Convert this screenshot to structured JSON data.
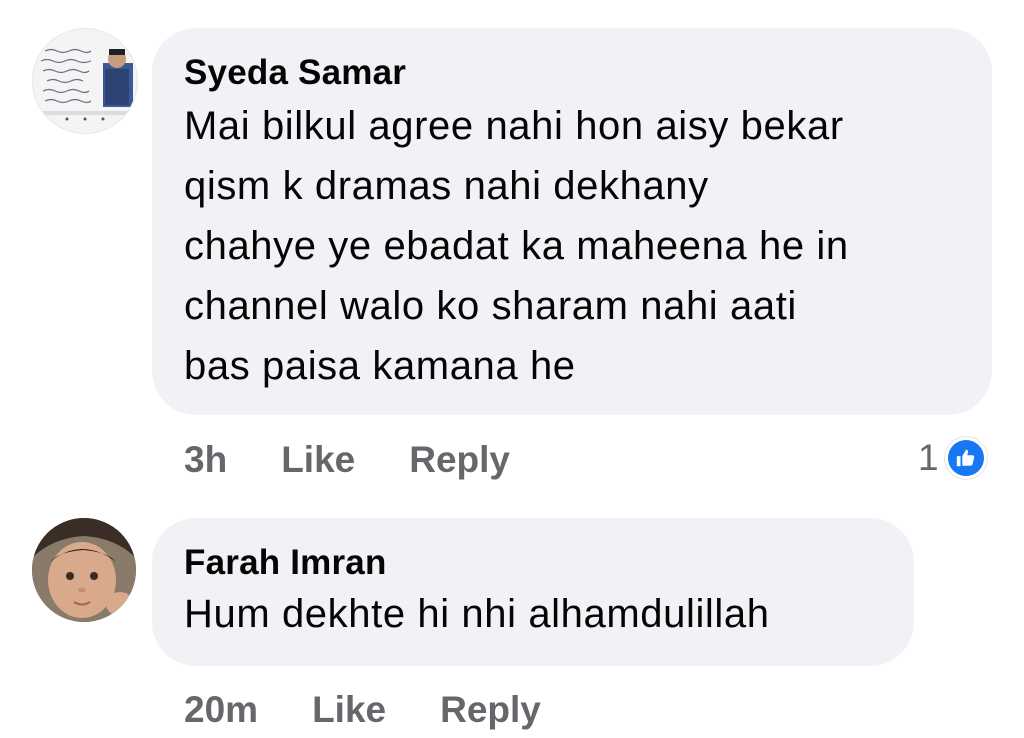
{
  "comments": [
    {
      "author": "Syeda Samar",
      "text_lines": [
        "Mai bilkul agree nahi hon aisy bekar",
        "qism k dramas nahi dekhany",
        "chahye ye ebadat ka maheena he in",
        "channel walo ko sharam nahi aati",
        "bas paisa kamana he"
      ],
      "time": "3h",
      "like_label": "Like",
      "reply_label": "Reply",
      "reaction_count": "1",
      "reaction_icon": "thumbs-up-icon",
      "avatar": "profile-avatar-urdu-post"
    },
    {
      "author": "Farah Imran",
      "text_lines": [
        "Hum dekhte hi nhi alhamdulillah"
      ],
      "time": "20m",
      "like_label": "Like",
      "reply_label": "Reply",
      "avatar": "profile-avatar-child"
    }
  ],
  "colors": {
    "bubble": "#f0f2f5",
    "secondary_text": "#65676b",
    "like_blue": "#1877f2"
  }
}
